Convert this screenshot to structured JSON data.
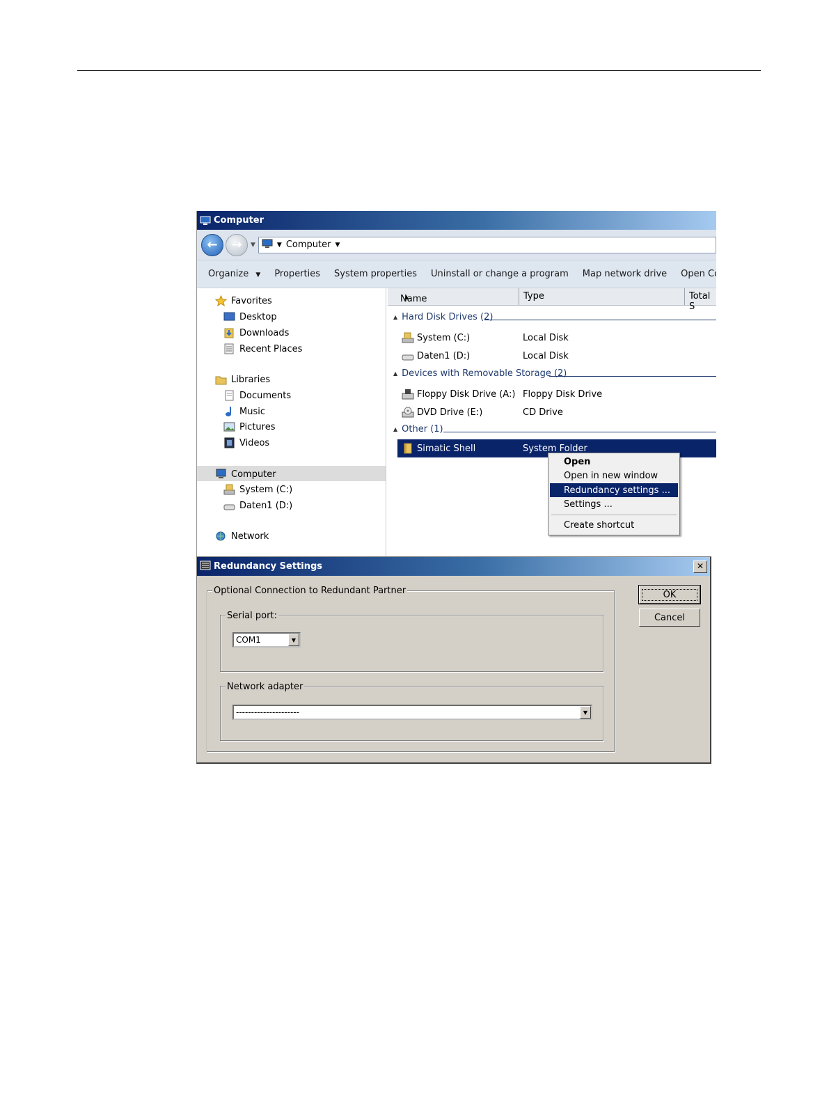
{
  "explorer": {
    "title": "Computer",
    "address": "Computer",
    "toolbar": [
      "Organize",
      "Properties",
      "System properties",
      "Uninstall or change a program",
      "Map network drive",
      "Open Control Panel"
    ],
    "nav": {
      "favorites": "Favorites",
      "desktop": "Desktop",
      "downloads": "Downloads",
      "recent": "Recent Places",
      "libraries": "Libraries",
      "documents": "Documents",
      "music": "Music",
      "pictures": "Pictures",
      "videos": "Videos",
      "computer": "Computer",
      "system_c": "System (C:)",
      "daten_d": "Daten1 (D:)",
      "network": "Network"
    },
    "columns": {
      "name": "Name",
      "type": "Type",
      "total": "Total S"
    },
    "groups": {
      "hdd": "Hard Disk Drives (2)",
      "removable": "Devices with Removable Storage (2)",
      "other": "Other (1)"
    },
    "rows": [
      {
        "name": "System (C:)",
        "type": "Local Disk"
      },
      {
        "name": "Daten1 (D:)",
        "type": "Local Disk"
      },
      {
        "name": "Floppy Disk Drive (A:)",
        "type": "Floppy Disk Drive"
      },
      {
        "name": "DVD Drive (E:)",
        "type": "CD Drive"
      },
      {
        "name": "Simatic Shell",
        "type": "System Folder"
      }
    ]
  },
  "context_menu": {
    "open": "Open",
    "open_new": "Open in new window",
    "redundancy": "Redundancy settings ...",
    "settings": "Settings ...",
    "shortcut": "Create shortcut"
  },
  "dialog": {
    "title": "Redundancy Settings",
    "group_label": "Optional Connection to Redundant Partner",
    "serial_label": "Serial port:",
    "serial_value": "COM1",
    "network_label": "Network adapter",
    "network_value": "---------------------",
    "ok": "OK",
    "cancel": "Cancel",
    "close": "✕"
  },
  "colors": {
    "title_dark": "#0a246a",
    "title_light": "#a6caf0",
    "selection": "#0a246a",
    "dialog_bg": "#d4d0c8"
  }
}
